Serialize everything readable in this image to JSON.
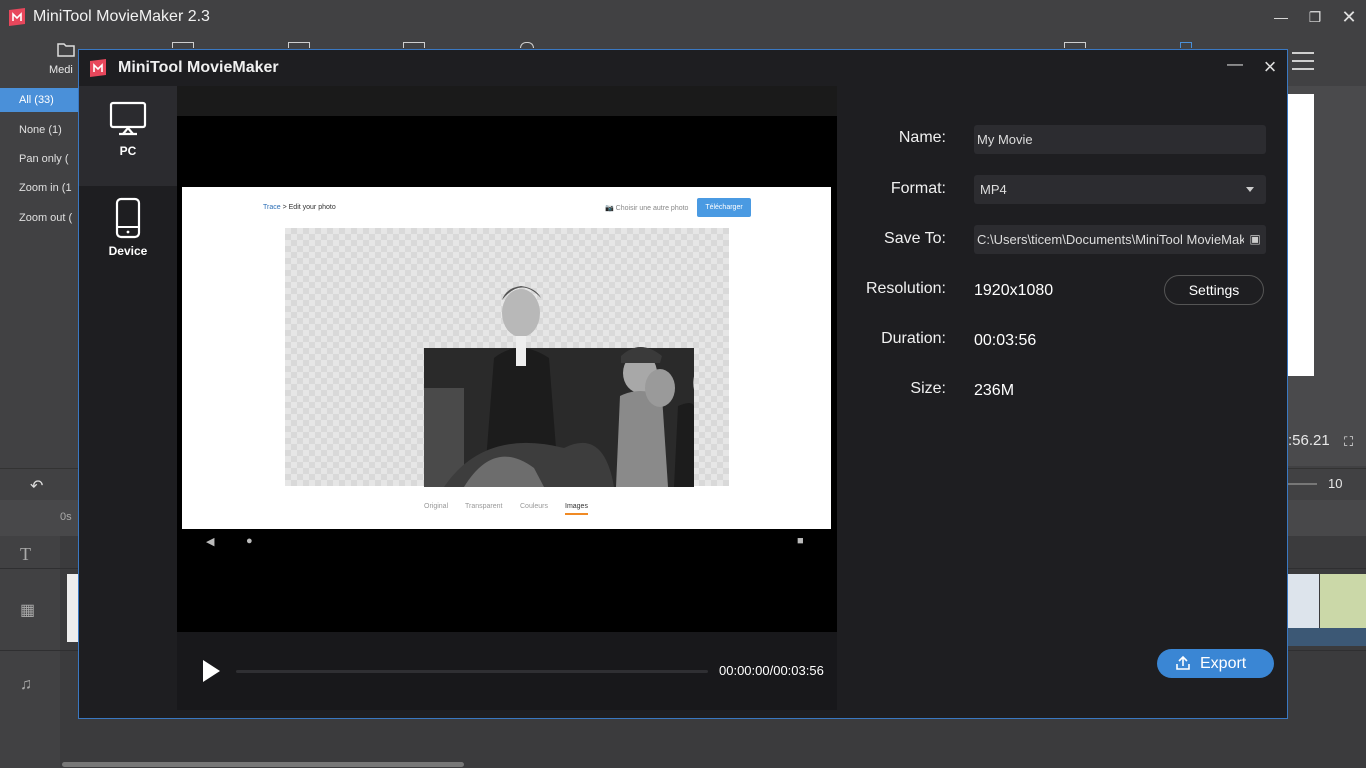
{
  "app": {
    "title": "MiniTool MovieMaker 2.3",
    "toolbar": {
      "media_label": "Medi"
    },
    "sidebar_filters": [
      "All  (33)",
      "None  (1)",
      "Pan only  (",
      "Zoom in  (1",
      "Zoom out  ("
    ],
    "preview_time": ":56.21",
    "zoom_value": "10",
    "ruler_start": "0s"
  },
  "dialog": {
    "title": "MiniTool MovieMaker",
    "destinations": [
      {
        "label": "PC",
        "icon": "monitor-icon",
        "active": true
      },
      {
        "label": "Device",
        "icon": "phone-icon",
        "active": false
      }
    ],
    "form": {
      "name_label": "Name:",
      "name_value": "My Movie",
      "format_label": "Format:",
      "format_value": "MP4",
      "save_to_label": "Save To:",
      "save_to_value": "C:\\Users\\ticem\\Documents\\MiniTool MovieMak",
      "resolution_label": "Resolution:",
      "resolution_value": "1920x1080",
      "settings_button": "Settings",
      "duration_label": "Duration:",
      "duration_value": "00:03:56",
      "size_label": "Size:",
      "size_value": "236M"
    },
    "export_button": "Export",
    "player": {
      "time": "00:00:00/00:03:56",
      "progress": 0
    },
    "preview_page": {
      "breadcrumb_link": "Trace",
      "breadcrumb_sep": ">",
      "breadcrumb_current": "Edit your photo",
      "choose_other": "Choisir une autre photo",
      "download": "Télécharger",
      "tabs": [
        "Original",
        "Transparent",
        "Couleurs",
        "Images"
      ],
      "active_tab": "Images"
    }
  },
  "colors": {
    "accent": "#3a86d4",
    "dialog_bg": "#1e1e21",
    "selected_filter": "#4a90d9"
  }
}
